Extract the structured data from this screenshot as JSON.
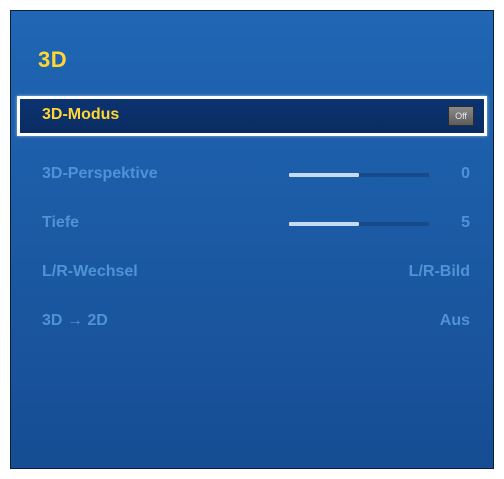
{
  "title": "3D",
  "rows": [
    {
      "label": "3D-Modus",
      "badge": "Off",
      "selected": true
    },
    {
      "label": "3D-Perspektive",
      "value": "0",
      "slider_level": 0.5
    },
    {
      "label": "Tiefe",
      "value": "5",
      "slider_level": 0.5
    },
    {
      "label": "L/R-Wechsel",
      "value": "L/R-Bild"
    },
    {
      "label": "3D → 2D",
      "value": "Aus"
    }
  ],
  "colors": {
    "panel_bg": "#1c5ba6",
    "title_yellow": "#ffd633",
    "label_blue": "#4f93d6",
    "selected_bg": "#0a2c62",
    "selected_border": "#ffffff"
  }
}
